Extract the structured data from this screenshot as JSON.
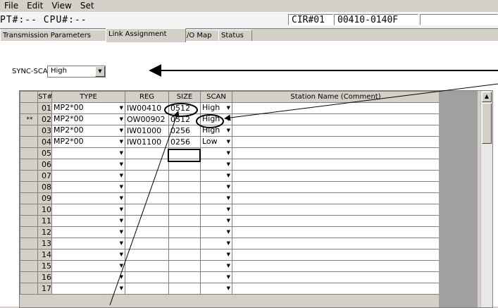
{
  "menu": [
    "File",
    "Edit",
    "View",
    "Set"
  ],
  "info": {
    "pt_cpu": "PT#:-- CPU#:--",
    "cir": "CIR#01",
    "address": "00410-0140F"
  },
  "tabs": [
    "Transmission Parameters",
    "Link Assignment",
    "I/O Map",
    "Status"
  ],
  "active_tab": "Link Assignment",
  "sync_scan": {
    "label": "SYNC-SCAN",
    "value": "High"
  },
  "grid": {
    "headers": {
      "st": "ST#",
      "type": "TYPE",
      "reg": "REG",
      "size": "SIZE",
      "scan": "SCAN",
      "station": "Station Name (Comment)"
    },
    "rows": [
      {
        "marker": "",
        "st": "01",
        "type": "MP2*00",
        "reg": "IW00410",
        "size": "0512",
        "scan": "High"
      },
      {
        "marker": "**",
        "st": "02",
        "type": "MP2*00",
        "reg": "OW00902",
        "size": "0512",
        "scan": "High"
      },
      {
        "marker": "",
        "st": "03",
        "type": "MP2*00",
        "reg": "IW01000",
        "size": "0256",
        "scan": "High"
      },
      {
        "marker": "",
        "st": "04",
        "type": "MP2*00",
        "reg": "IW01100",
        "size": "0256",
        "scan": "Low"
      },
      {
        "marker": "",
        "st": "05",
        "type": "",
        "reg": "",
        "size": "",
        "scan": ""
      },
      {
        "marker": "",
        "st": "06",
        "type": "",
        "reg": "",
        "size": "",
        "scan": ""
      },
      {
        "marker": "",
        "st": "07",
        "type": "",
        "reg": "",
        "size": "",
        "scan": ""
      },
      {
        "marker": "",
        "st": "08",
        "type": "",
        "reg": "",
        "size": "",
        "scan": ""
      },
      {
        "marker": "",
        "st": "09",
        "type": "",
        "reg": "",
        "size": "",
        "scan": ""
      },
      {
        "marker": "",
        "st": "10",
        "type": "",
        "reg": "",
        "size": "",
        "scan": ""
      },
      {
        "marker": "",
        "st": "11",
        "type": "",
        "reg": "",
        "size": "",
        "scan": ""
      },
      {
        "marker": "",
        "st": "12",
        "type": "",
        "reg": "",
        "size": "",
        "scan": ""
      },
      {
        "marker": "",
        "st": "13",
        "type": "",
        "reg": "",
        "size": "",
        "scan": ""
      },
      {
        "marker": "",
        "st": "14",
        "type": "",
        "reg": "",
        "size": "",
        "scan": ""
      },
      {
        "marker": "",
        "st": "15",
        "type": "",
        "reg": "",
        "size": "",
        "scan": ""
      },
      {
        "marker": "",
        "st": "16",
        "type": "",
        "reg": "",
        "size": "",
        "scan": ""
      },
      {
        "marker": "",
        "st": "17",
        "type": "",
        "reg": "",
        "size": "",
        "scan": ""
      }
    ]
  },
  "icons": {
    "dropdown": "dropdown-arrow-icon",
    "scroll_up": "scroll-up-arrow-icon"
  }
}
